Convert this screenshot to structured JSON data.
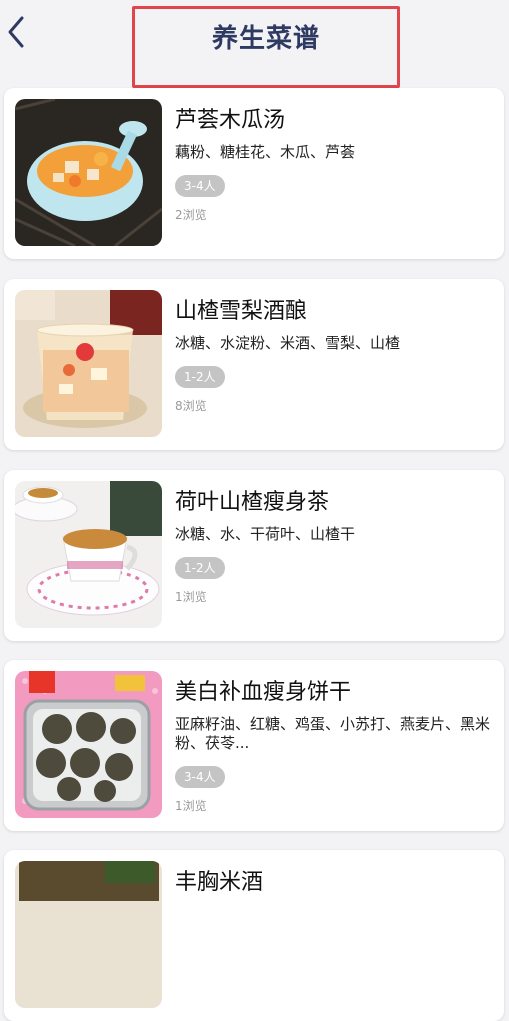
{
  "header": {
    "title": "养生菜谱"
  },
  "recipes": [
    {
      "name": "芦荟木瓜汤",
      "ingredients": "藕粉、糖桂花、木瓜、芦荟",
      "servings": "3-4人",
      "views": "2浏览"
    },
    {
      "name": "山楂雪梨酒酿",
      "ingredients": "冰糖、水淀粉、米酒、雪梨、山楂",
      "servings": "1-2人",
      "views": "8浏览"
    },
    {
      "name": "荷叶山楂瘦身茶",
      "ingredients": "冰糖、水、干荷叶、山楂干",
      "servings": "1-2人",
      "views": "1浏览"
    },
    {
      "name": "美白补血瘦身饼干",
      "ingredients": "亚麻籽油、红糖、鸡蛋、小苏打、燕麦片、黑米粉、茯苓...",
      "servings": "3-4人",
      "views": "1浏览"
    },
    {
      "name": "丰胸米酒",
      "ingredients": "",
      "servings": "",
      "views": ""
    }
  ],
  "colors": {
    "title": "#2f3a63",
    "highlight_border": "#e0464c",
    "badge_bg": "#c4c4c4",
    "page_bg": "#f3f3f5"
  },
  "icons": {
    "back": "chevron-left-icon"
  }
}
